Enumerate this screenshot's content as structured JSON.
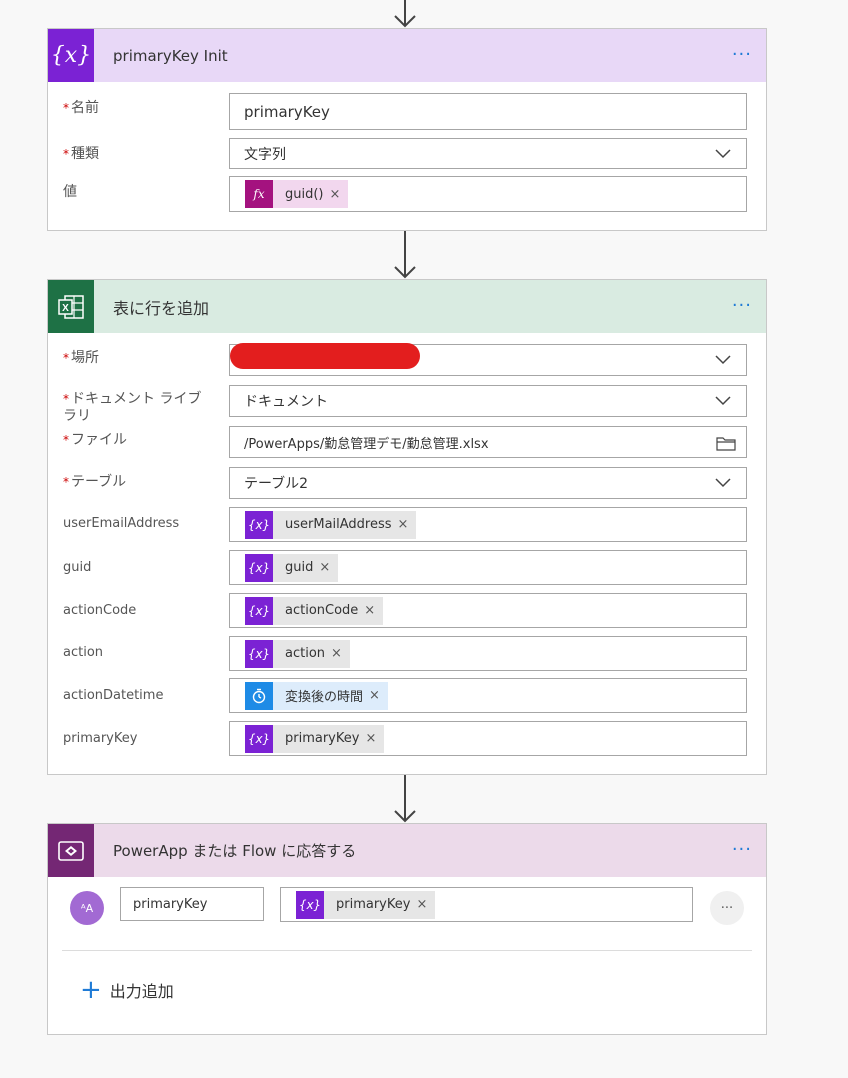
{
  "card1": {
    "title": "primaryKey Init",
    "icon": "variable-icon",
    "more": "···",
    "fields": {
      "name_label": "名前",
      "name_value": "primaryKey",
      "type_label": "種類",
      "type_value": "文字列",
      "value_label": "値",
      "value_token": "guid()"
    }
  },
  "card2": {
    "title": "表に行を追加",
    "icon": "excel-icon",
    "more": "···",
    "location_label": "場所",
    "doclib_label": "ドキュメント ライブラリ",
    "doclib_value": "ドキュメント",
    "file_label": "ファイル",
    "file_value": "/PowerApps/勤怠管理デモ/勤怠管理.xlsx",
    "table_label": "テーブル",
    "table_value": "テーブル2",
    "rows": [
      {
        "label": "userEmailAddress",
        "token": "userMailAddress"
      },
      {
        "label": "guid",
        "token": "guid"
      },
      {
        "label": "actionCode",
        "token": "actionCode"
      },
      {
        "label": "action",
        "token": "action"
      },
      {
        "label": "actionDatetime",
        "token": "変換後の時間"
      },
      {
        "label": "primaryKey",
        "token": "primaryKey"
      }
    ]
  },
  "card3": {
    "title": "PowerApp または Flow に応答する",
    "icon": "powerapps-icon",
    "more": "···",
    "output_name": "primaryKey",
    "output_token": "primaryKey",
    "add_output": "出力追加",
    "row_menu": "···"
  },
  "token_close": "×",
  "token_icon_text": "{x}",
  "fx_icon_text": "fx",
  "colors": {
    "variable_header": "#e8d8f7",
    "variable_icon": "#7b22d4",
    "excel_header": "#d9ebe1",
    "excel_icon": "#1e7145",
    "powerapps_header": "#ecdaea",
    "powerapps_icon": "#742774",
    "accent": "#1f7bd6"
  }
}
